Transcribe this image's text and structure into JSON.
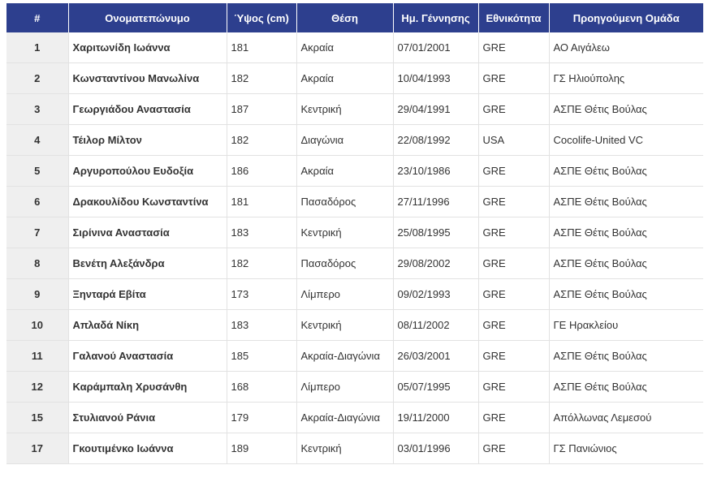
{
  "table": {
    "headers": [
      "#",
      "Ονοματεπώνυμο",
      "Ύψος (cm)",
      "Θέση",
      "Ημ. Γέννησης",
      "Εθνικότητα",
      "Προηγούμενη Ομάδα"
    ],
    "rows": [
      [
        "1",
        "Χαριτωνίδη Ιωάννα",
        "181",
        "Ακραία",
        "07/01/2001",
        "GRE",
        "ΑΟ Αιγάλεω"
      ],
      [
        "2",
        "Κωνσταντίνου Μανωλίνα",
        "182",
        "Ακραία",
        "10/04/1993",
        "GRE",
        "ΓΣ Ηλιούπολης"
      ],
      [
        "3",
        "Γεωργιάδου Αναστασία",
        "187",
        "Κεντρική",
        "29/04/1991",
        "GRE",
        "ΑΣΠΕ Θέτις Βούλας"
      ],
      [
        "4",
        "Τέιλορ Μίλτον",
        "182",
        "Διαγώνια",
        "22/08/1992",
        "USA",
        "Cocolife-United VC"
      ],
      [
        "5",
        "Αργυροπούλου Ευδοξία",
        "186",
        "Ακραία",
        "23/10/1986",
        "GRE",
        "ΑΣΠΕ Θέτις Βούλας"
      ],
      [
        "6",
        "Δρακουλίδου Κωνσταντίνα",
        "181",
        "Πασαδόρος",
        "27/11/1996",
        "GRE",
        "ΑΣΠΕ Θέτις Βούλας"
      ],
      [
        "7",
        "Σιρίνινα Αναστασία",
        "183",
        "Κεντρική",
        "25/08/1995",
        "GRE",
        "ΑΣΠΕ Θέτις Βούλας"
      ],
      [
        "8",
        "Βενέτη Αλεξάνδρα",
        "182",
        "Πασαδόρος",
        "29/08/2002",
        "GRE",
        "ΑΣΠΕ Θέτις Βούλας"
      ],
      [
        "9",
        "Ξηνταρά Εβίτα",
        "173",
        "Λίμπερο",
        "09/02/1993",
        "GRE",
        "ΑΣΠΕ Θέτις Βούλας"
      ],
      [
        "10",
        "Απλαδά Νίκη",
        "183",
        "Κεντρική",
        "08/11/2002",
        "GRE",
        "ΓΕ Ηρακλείου"
      ],
      [
        "11",
        "Γαλανού Αναστασία",
        "185",
        "Ακραία-Διαγώνια",
        "26/03/2001",
        "GRE",
        "ΑΣΠΕ Θέτις Βούλας"
      ],
      [
        "12",
        "Καράμπαλη Χρυσάνθη",
        "168",
        "Λίμπερο",
        "05/07/1995",
        "GRE",
        "ΑΣΠΕ Θέτις Βούλας"
      ],
      [
        "15",
        "Στυλιανού Ράνια",
        "179",
        "Ακραία-Διαγώνια",
        "19/11/2000",
        "GRE",
        "Απόλλωνας Λεμεσού"
      ],
      [
        "17",
        "Γκουτιμένκο Ιωάννα",
        "189",
        "Κεντρική",
        "03/01/1996",
        "GRE",
        "ΓΣ Πανιώνιος"
      ]
    ]
  },
  "colors": {
    "header_bg": "#2d3f8e",
    "header_text": "#ffffff",
    "number_cell_bg": "#efefef",
    "border": "#e2e2e2"
  }
}
